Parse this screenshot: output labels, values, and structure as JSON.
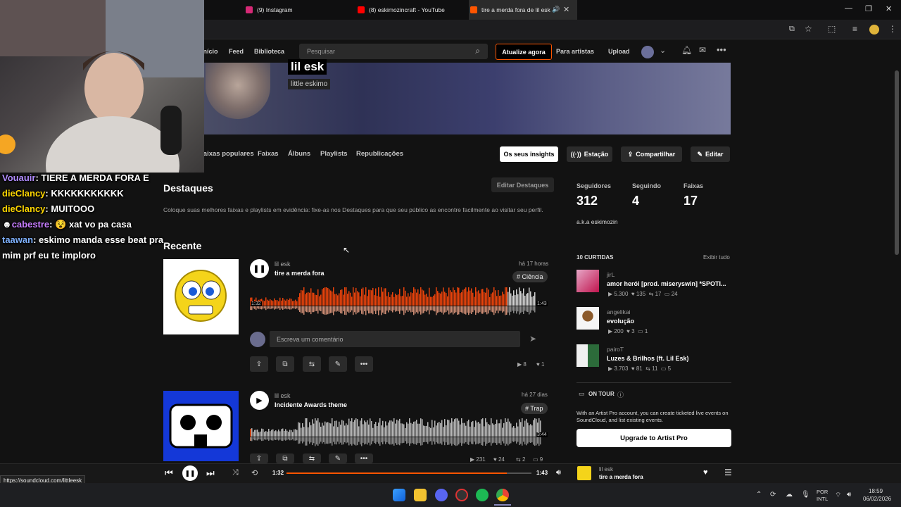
{
  "browser": {
    "tabs": [
      {
        "label": "(9) Instagram",
        "color": "#d62976"
      },
      {
        "label": "(8) eskimozincraft - YouTube",
        "color": "#ff0000"
      },
      {
        "label": "tire a merda fora de lil esk",
        "color": "#ff5500"
      }
    ],
    "new_tab": "+",
    "status_url": "https://soundcloud.com/littleesk"
  },
  "header": {
    "nav": [
      "Início",
      "Feed",
      "Biblioteca"
    ],
    "search_placeholder": "Pesquisar",
    "upgrade_label": "Atualize agora",
    "artists_label": "Para artistas",
    "upload_label": "Upload"
  },
  "profile": {
    "name": "lil esk",
    "subtitle": "little eskimo",
    "tabs": [
      "Faixas populares",
      "Faixas",
      "Álbuns",
      "Playlists",
      "Republicações"
    ],
    "insights_label": "Os seus insights",
    "station_label": "Estação",
    "share_label": "Compartilhar",
    "edit_label": "Editar"
  },
  "highlights": {
    "title": "Destaques",
    "edit_label": "Editar Destaques",
    "description": "Coloque suas melhores faixas e playlists em evidência: fixe-as nos Destaques para que seu público as encontre facilmente ao visitar seu perfil."
  },
  "recent": {
    "title": "Recente",
    "tracks": [
      {
        "artist": "lil esk",
        "title": "tire a merda fora",
        "time": "há 17 horas",
        "tag": "# Ciência",
        "position": "1:32",
        "duration": "1:43",
        "played_fraction": 0.9,
        "comment_placeholder": "Escreva um comentário",
        "plays": "8",
        "likes": "1"
      },
      {
        "artist": "lil esk",
        "title": "Incidente Awards theme",
        "time": "há 27 dias",
        "tag": "# Trap",
        "duration": "3:44",
        "plays": "231",
        "likes": "24",
        "reposts": "2",
        "comments": "9"
      }
    ]
  },
  "sidebar": {
    "stats": [
      {
        "label": "Seguidores",
        "value": "312"
      },
      {
        "label": "Seguindo",
        "value": "4"
      },
      {
        "label": "Faixas",
        "value": "17"
      }
    ],
    "aka": "a.k.a eskimozin",
    "likes_title": "10 CURTIDAS",
    "view_all": "Exibir tudo",
    "liked": [
      {
        "user": "jirL",
        "title": "amor herói [prod. miseryswin] *SPOTI...",
        "plays": "5.300",
        "likes": "135",
        "reposts": "17",
        "comments": "24"
      },
      {
        "user": "angelikai",
        "title": "evolução",
        "plays": "200",
        "likes": "3",
        "comments": "1"
      },
      {
        "user": "pairoT",
        "title": "Luzes & Brilhos (ft. Lil Esk)",
        "plays": "3.703",
        "likes": "81",
        "reposts": "11",
        "comments": "5"
      }
    ],
    "on_tour_title": "ON TOUR",
    "on_tour_text": "With an Artist Pro account, you can create ticketed live events on SoundCloud, and list existing events.",
    "upgrade_pro": "Upgrade to Artist Pro"
  },
  "player": {
    "current": "1:32",
    "duration": "1:43",
    "progress_fraction": 0.9,
    "artist": "lil esk",
    "title": "tire a merda fora"
  },
  "chat": [
    {
      "user": "Vouauir",
      "color": "#b18cff",
      "msg": "TIERE A MERDA FORA E"
    },
    {
      "user": "dieClancy",
      "color": "#ffd700",
      "msg": "KKKKKKKKKKK"
    },
    {
      "user": "dieClancy",
      "color": "#ffd700",
      "msg": "MUITOOO"
    },
    {
      "user": "cabestre",
      "color": "#c77dff",
      "msg": "xat vo pa casa"
    },
    {
      "user": "taawan",
      "color": "#7fb2ff",
      "msg": "eskimo manda esse beat pra"
    },
    {
      "user": "",
      "color": "#ffffff",
      "msg": "mim prf eu te imploro"
    }
  ],
  "taskbar": {
    "lang": "POR",
    "layout": "INTL",
    "time": "18:59",
    "date": "06/02/2026"
  }
}
